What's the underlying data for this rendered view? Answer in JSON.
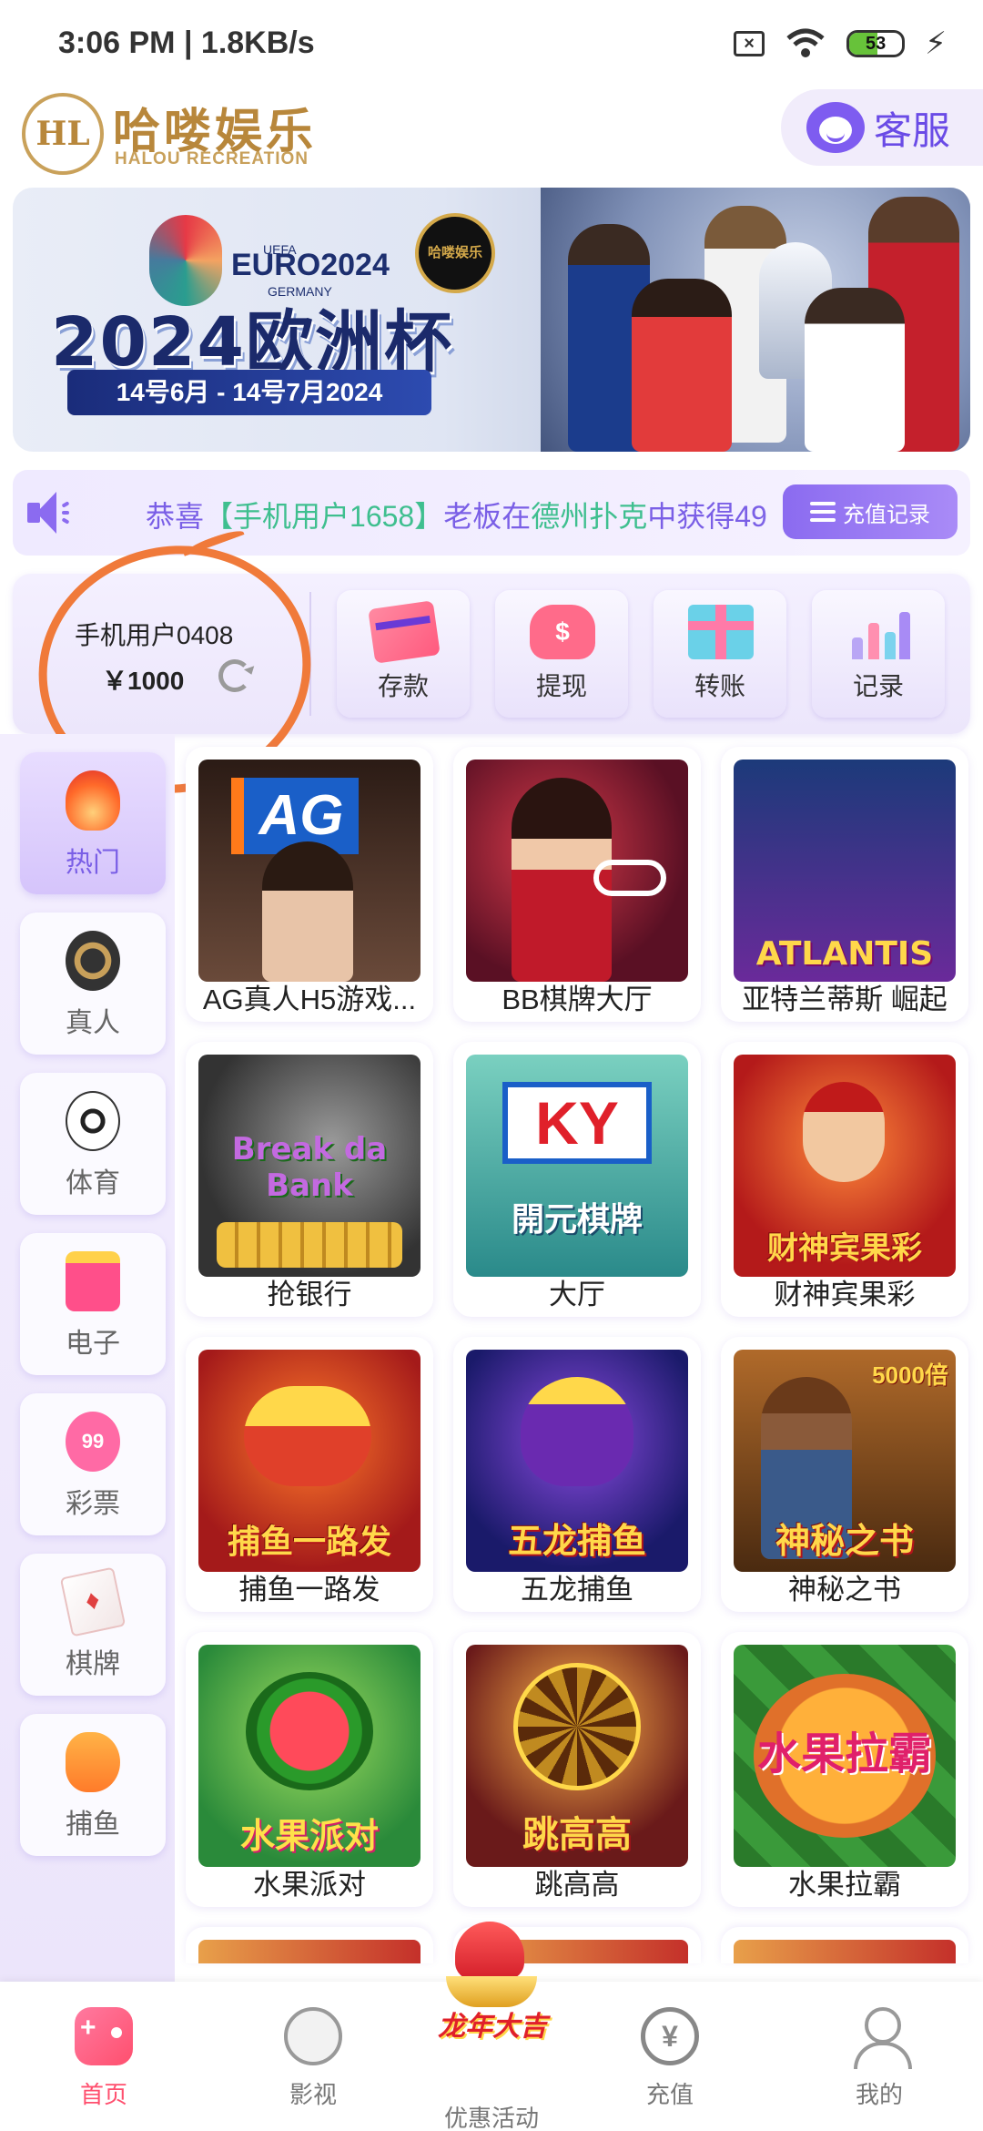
{
  "status_bar": {
    "time": "3:06 PM",
    "speed": "1.8KB/s",
    "battery": "53",
    "battery_level": 0.53
  },
  "header": {
    "logo_mark": "HL",
    "brand_cn": "哈喽娱乐",
    "brand_en": "HALOU RECREATION",
    "support_label": "客服"
  },
  "banner": {
    "euro_top": "UEFA",
    "euro_brand": "EURO2024",
    "euro_country": "GERMANY",
    "seal": "哈喽娱乐",
    "title": "2024欧洲杯",
    "date_range": "14号6月 - 14号7月2024"
  },
  "notice": {
    "prefix": "恭喜",
    "user": "【手机用户1658】",
    "mid": "老板在",
    "game": "德州扑克",
    "suffix": "中获得49",
    "button_label": "充值记录"
  },
  "account": {
    "username": "手机用户0408",
    "balance": "￥1000"
  },
  "actions": [
    {
      "label": "存款",
      "icon": "card-icon"
    },
    {
      "label": "提现",
      "icon": "money-bag-icon"
    },
    {
      "label": "转账",
      "icon": "gift-icon"
    },
    {
      "label": "记录",
      "icon": "bar-chart-icon"
    }
  ],
  "categories": [
    {
      "label": "热门",
      "icon": "fire-icon",
      "active": true
    },
    {
      "label": "真人",
      "icon": "casino-chip-icon"
    },
    {
      "label": "体育",
      "icon": "soccer-ball-icon"
    },
    {
      "label": "电子",
      "icon": "slot-machine-icon"
    },
    {
      "label": "彩票",
      "icon": "lottery-ball-icon"
    },
    {
      "label": "棋牌",
      "icon": "playing-card-icon"
    },
    {
      "label": "捕鱼",
      "icon": "shark-icon"
    }
  ],
  "games": [
    {
      "title": "AG真人H5游戏...",
      "thumb_text": "AG"
    },
    {
      "title": "BB棋牌大厅",
      "thumb_text": ""
    },
    {
      "title": "亚特兰蒂斯 崛起",
      "thumb_text": "ATLANTIS"
    },
    {
      "title": "抢银行",
      "thumb_text": "Break da Bank"
    },
    {
      "title": "大厅",
      "thumb_text": "開元棋牌"
    },
    {
      "title": "财神宾果彩",
      "thumb_text": "财神宾果彩"
    },
    {
      "title": "捕鱼一路发",
      "thumb_text": "捕鱼一路发"
    },
    {
      "title": "五龙捕鱼",
      "thumb_text": "五龙捕鱼"
    },
    {
      "title": "神秘之书",
      "thumb_text": "神秘之书"
    },
    {
      "title": "水果派对",
      "thumb_text": "水果派对"
    },
    {
      "title": "跳高高",
      "thumb_text": "跳高高"
    },
    {
      "title": "水果拉霸",
      "thumb_text": "水果拉霸"
    }
  ],
  "tabbar": {
    "items": [
      {
        "label": "首页",
        "icon": "gamepad-icon",
        "active": true
      },
      {
        "label": "影视",
        "icon": "portrait-icon"
      },
      {
        "label": "优惠活动",
        "icon": "dragon-promo-icon",
        "slogan": "龙年大吉"
      },
      {
        "label": "充值",
        "icon": "yen-plus-icon"
      },
      {
        "label": "我的",
        "icon": "user-icon"
      }
    ]
  },
  "colors": {
    "accent_purple": "#7a5fe6",
    "active_tab": "#ff4f6e",
    "annotation": "#f07a3a",
    "brand_gold": "#b8873b"
  }
}
